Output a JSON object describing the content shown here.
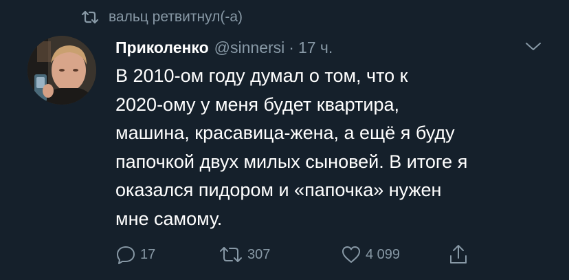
{
  "retweet": {
    "text": "вальц ретвитнул(-а)",
    "icon": "retweet-icon"
  },
  "tweet": {
    "display_name": "Приколенко",
    "handle": "@sinnersi",
    "separator": "·",
    "time": "17 ч.",
    "text_lines": [
      "В 2010-ом году думал о том, что к",
      "2020-ому у меня будет квартира,",
      "машина, красавица-жена, а ещё я буду",
      "папочкой двух милых сыновей. В итоге я",
      "оказался пидором и «папочка» нужен",
      "мне самому."
    ]
  },
  "actions": {
    "reply_count": "17",
    "retweet_count": "307",
    "like_count": "4 099",
    "reply_icon": "reply-icon",
    "retweet_icon": "retweet-icon",
    "like_icon": "heart-icon",
    "share_icon": "share-icon"
  },
  "colors": {
    "background": "#15202b",
    "secondary_text": "#8899a6",
    "primary_text": "#ffffff"
  }
}
